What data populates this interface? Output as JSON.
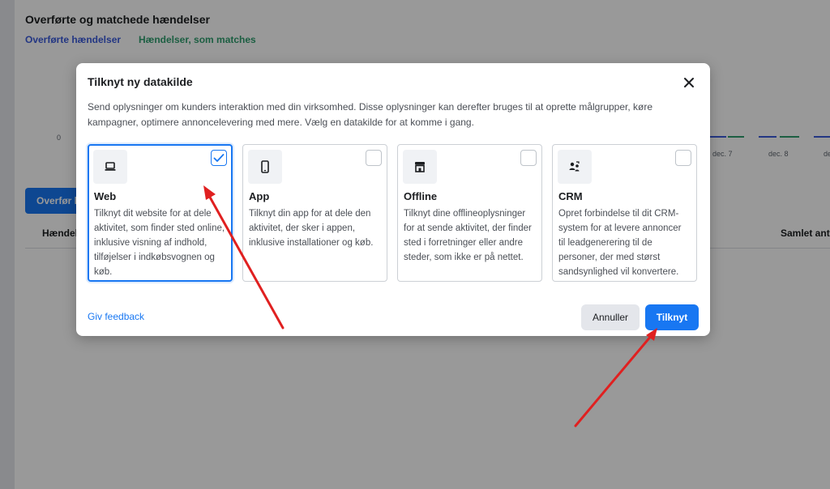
{
  "background": {
    "title": "Overførte og matchede hændelser",
    "legend": [
      {
        "label": "Overførte hændelser",
        "color": "#3b5bdb"
      },
      {
        "label": "Hændelser, som matches",
        "color": "#2f9e6e"
      }
    ],
    "y_zero": "0",
    "x_ticks": [
      "dec. 7",
      "dec. 8",
      "de"
    ],
    "button_label": "Overfør h",
    "table_headers": [
      "Hændel",
      "Samlet anta"
    ]
  },
  "modal": {
    "title": "Tilknyt ny datakilde",
    "close_icon": "close-icon",
    "intro": "Send oplysninger om kunders interaktion med din virksomhed. Disse oplysninger kan derefter bruges til at oprette målgrupper, køre kampagner, optimere annoncelevering med mere. Vælg en datakilde for at komme i gang.",
    "sources": [
      {
        "title": "Web",
        "icon": "laptop-icon",
        "selected": true,
        "description": "Tilknyt dit website for at dele aktivitet, som finder sted online, inklusive visning af indhold, tilføjelser i indkøbsvognen og køb."
      },
      {
        "title": "App",
        "icon": "mobile-icon",
        "selected": false,
        "description": "Tilknyt din app for at dele den aktivitet, der sker i appen, inklusive installationer og køb."
      },
      {
        "title": "Offline",
        "icon": "store-icon",
        "selected": false,
        "description": "Tilknyt dine offlineoplysninger for at sende aktivitet, der finder sted i forretninger eller andre steder, som ikke er på nettet."
      },
      {
        "title": "CRM",
        "icon": "crm-icon",
        "selected": false,
        "description": "Opret forbindelse til dit CRM-system for at levere annoncer til leadgenerering til de personer, der med størst sandsynlighed vil konvertere."
      }
    ],
    "feedback_link": "Giv feedback",
    "cancel_label": "Annuller",
    "connect_label": "Tilknyt"
  },
  "colors": {
    "primary": "#1877f2",
    "annotation_arrow": "#e02020"
  }
}
